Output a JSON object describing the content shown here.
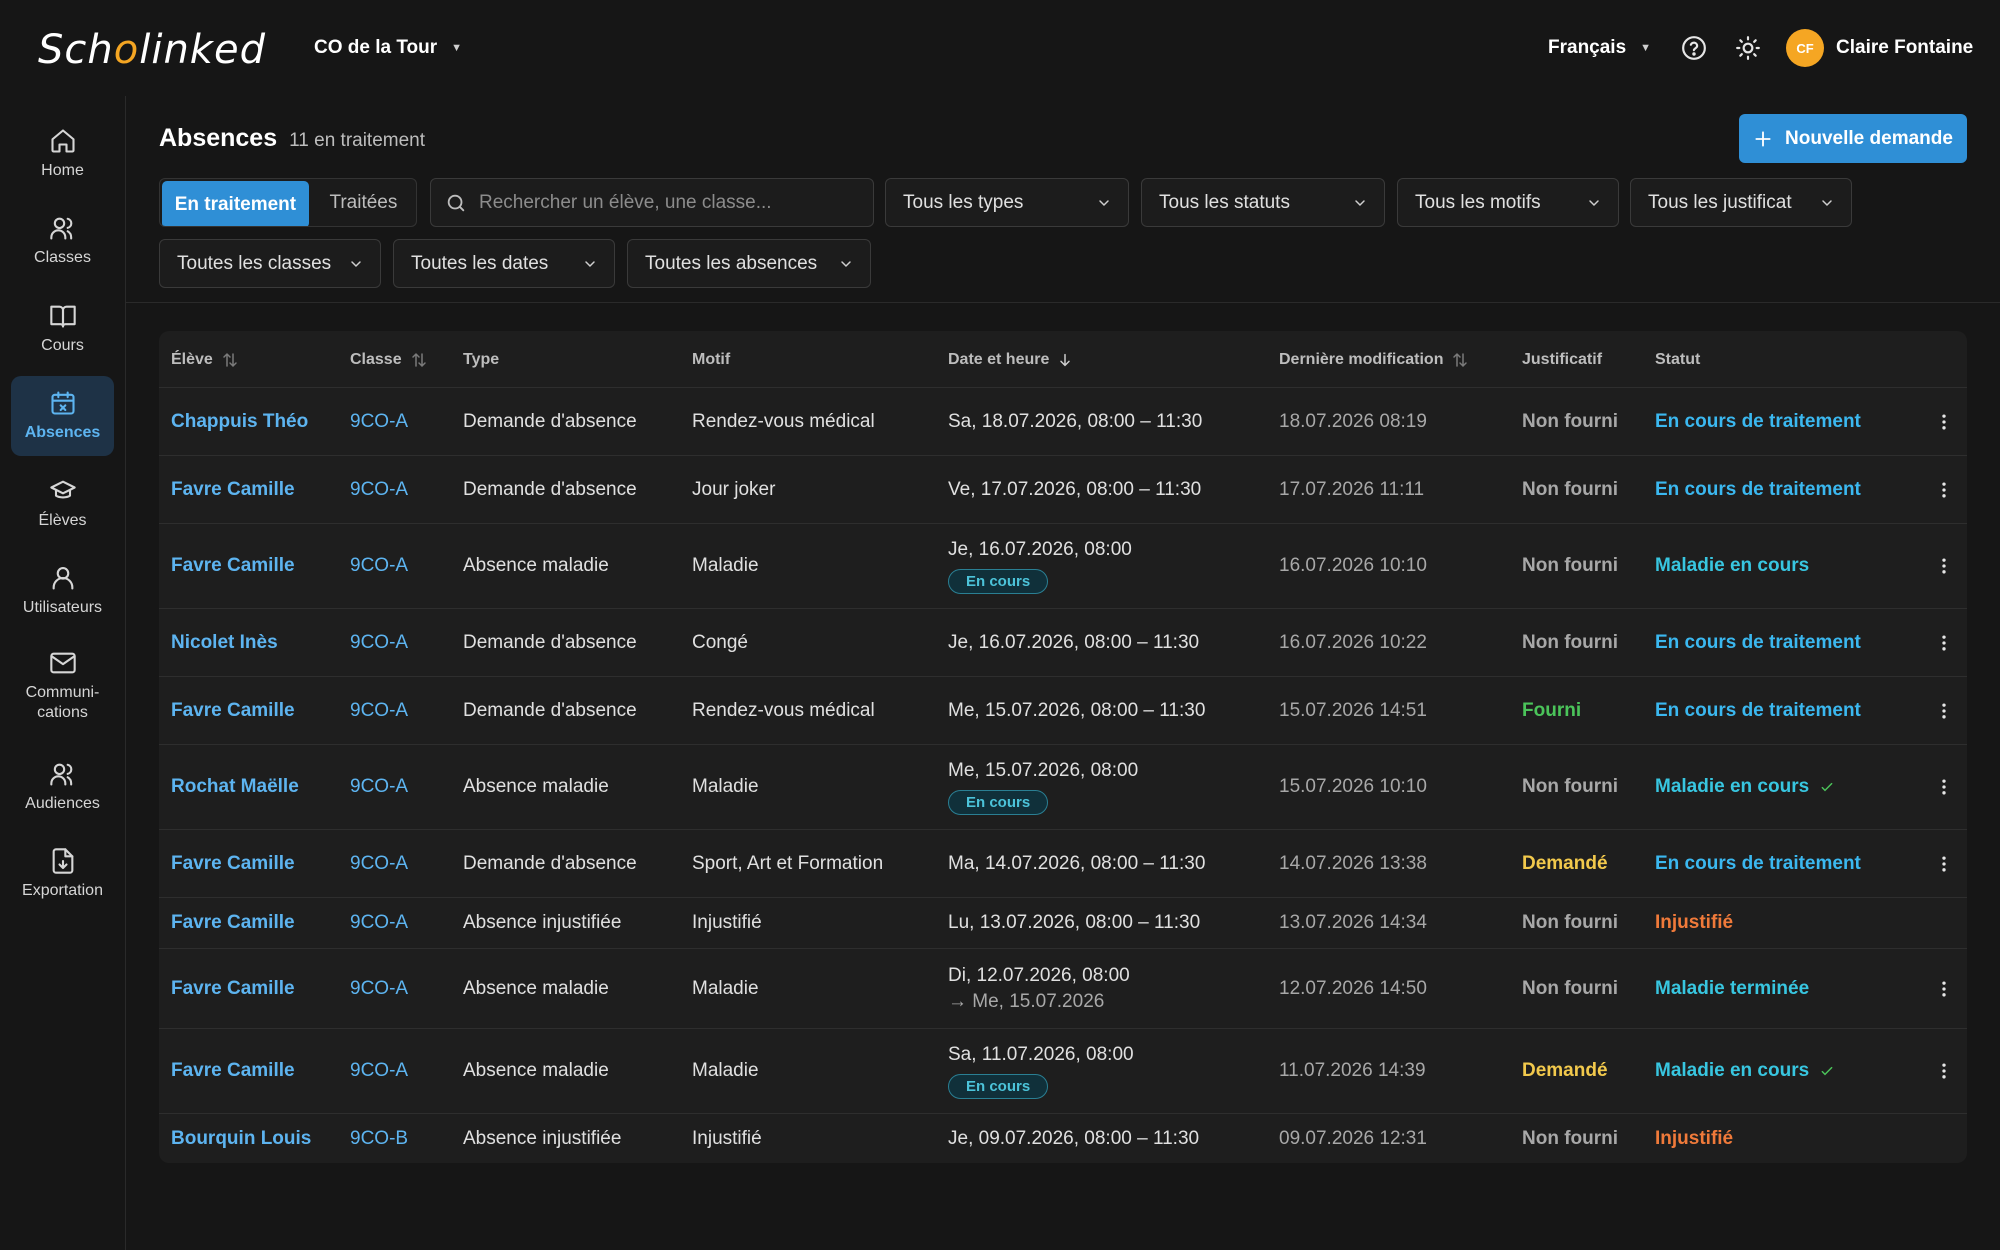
{
  "app": {
    "logo_prefix": "Sch",
    "logo_accent": "o",
    "logo_suffix": "linked",
    "school": "CO de la Tour",
    "language": "Français",
    "user_initials": "CF",
    "user_name": "Claire Fontaine"
  },
  "colors": {
    "accent": "#2f8fd6",
    "link": "#5db4f0",
    "status_blue": "#3bb8f0",
    "status_cyan": "#38c6e0",
    "status_orange": "#f07a3a",
    "just_green": "#4bc45a",
    "just_yellow": "#f2c94c",
    "avatar": "#f5a623"
  },
  "sidebar": {
    "items": [
      {
        "label": "Home",
        "icon": "home-icon"
      },
      {
        "label": "Classes",
        "icon": "users-icon"
      },
      {
        "label": "Cours",
        "icon": "book-icon"
      },
      {
        "label": "Absences",
        "icon": "calendar-x-icon",
        "active": true
      },
      {
        "label": "Élèves",
        "icon": "graduation-cap-icon"
      },
      {
        "label": "Utilisateurs",
        "icon": "user-icon"
      },
      {
        "label_line1": "Communi-",
        "label_line2": "cations",
        "icon": "mail-icon"
      },
      {
        "label": "Audiences",
        "icon": "audience-icon"
      },
      {
        "label": "Exportation",
        "icon": "export-icon"
      }
    ]
  },
  "header": {
    "title": "Absences",
    "count": "11 en traitement",
    "new_button": "Nouvelle demande"
  },
  "filters": {
    "seg_active": "En traitement",
    "seg_other": "Traitées",
    "search_placeholder": "Rechercher un élève, une classe...",
    "types": "Tous les types",
    "statuts": "Tous les statuts",
    "motifs": "Tous les motifs",
    "justificatifs": "Tous les justificat",
    "classes": "Toutes les classes",
    "dates": "Toutes les dates",
    "absences": "Toutes les absences"
  },
  "table": {
    "columns": {
      "eleve": "Élève",
      "classe": "Classe",
      "type": "Type",
      "motif": "Motif",
      "date": "Date et heure",
      "modif": "Dernière modification",
      "justificatif": "Justificatif",
      "statut": "Statut"
    },
    "rows": [
      {
        "eleve": "Chappuis Théo",
        "classe": "9CO-A",
        "type": "Demande d'absence",
        "motif": "Rendez-vous médical",
        "date": "Sa, 18.07.2026, 08:00 – 11:30",
        "modif": "18.07.2026 08:19",
        "justificatif": "Non fourni",
        "statut": "En cours de traitement"
      },
      {
        "eleve": "Favre Camille",
        "classe": "9CO-A",
        "type": "Demande d'absence",
        "motif": "Jour joker",
        "date": "Ve, 17.07.2026, 08:00 – 11:30",
        "modif": "17.07.2026 11:11",
        "justificatif": "Non fourni",
        "statut": "En cours de traitement"
      },
      {
        "eleve": "Favre Camille",
        "classe": "9CO-A",
        "type": "Absence maladie",
        "motif": "Maladie",
        "date": "Je, 16.07.2026, 08:00",
        "badge": "En cours",
        "modif": "16.07.2026 10:10",
        "justificatif": "Non fourni",
        "statut": "Maladie en cours"
      },
      {
        "eleve": "Nicolet Inès",
        "classe": "9CO-A",
        "type": "Demande d'absence",
        "motif": "Congé",
        "date": "Je, 16.07.2026, 08:00 – 11:30",
        "modif": "16.07.2026 10:22",
        "justificatif": "Non fourni",
        "statut": "En cours de traitement"
      },
      {
        "eleve": "Favre Camille",
        "classe": "9CO-A",
        "type": "Demande d'absence",
        "motif": "Rendez-vous médical",
        "date": "Me, 15.07.2026, 08:00 – 11:30",
        "modif": "15.07.2026 14:51",
        "justificatif": "Fourni",
        "statut": "En cours de traitement"
      },
      {
        "eleve": "Rochat Maëlle",
        "classe": "9CO-A",
        "type": "Absence maladie",
        "motif": "Maladie",
        "date": "Me, 15.07.2026, 08:00",
        "badge": "En cours",
        "modif": "15.07.2026 10:10",
        "justificatif": "Non fourni",
        "statut": "Maladie en cours"
      },
      {
        "eleve": "Favre Camille",
        "classe": "9CO-A",
        "type": "Demande d'absence",
        "motif": "Sport, Art et Formation",
        "date": "Ma, 14.07.2026, 08:00 – 11:30",
        "modif": "14.07.2026 13:38",
        "justificatif": "Demandé",
        "statut": "En cours de traitement"
      },
      {
        "eleve": "Favre Camille",
        "classe": "9CO-A",
        "type": "Absence injustifiée",
        "motif": "Injustifié",
        "date": "Lu, 13.07.2026, 08:00 – 11:30",
        "modif": "13.07.2026 14:34",
        "justificatif": "Non fourni",
        "statut": "Injustifié"
      },
      {
        "eleve": "Favre Camille",
        "classe": "9CO-A",
        "type": "Absence maladie",
        "motif": "Maladie",
        "date": "Di, 12.07.2026, 08:00",
        "date2": "→ Me, 15.07.2026",
        "modif": "12.07.2026 14:50",
        "justificatif": "Non fourni",
        "statut": "Maladie terminée"
      },
      {
        "eleve": "Favre Camille",
        "classe": "9CO-A",
        "type": "Absence maladie",
        "motif": "Maladie",
        "date": "Sa, 11.07.2026, 08:00",
        "badge": "En cours",
        "modif": "11.07.2026 14:39",
        "justificatif": "Demandé",
        "statut": "Maladie en cours"
      },
      {
        "eleve": "Bourquin Louis",
        "classe": "9CO-B",
        "type": "Absence injustifiée",
        "motif": "Injustifié",
        "date": "Je, 09.07.2026, 08:00 – 11:30",
        "modif": "09.07.2026 12:31",
        "justificatif": "Non fourni",
        "statut": "Injustifié"
      }
    ]
  }
}
